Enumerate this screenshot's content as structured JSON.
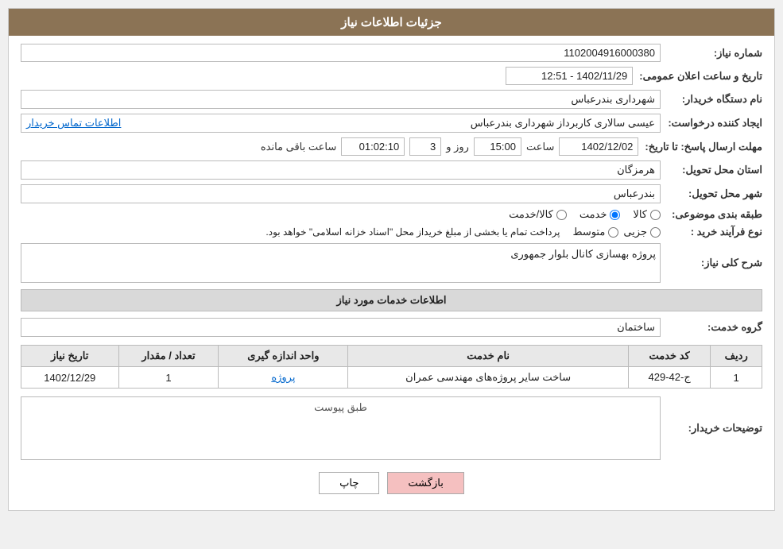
{
  "page": {
    "title": "جزئیات اطلاعات نیاز"
  },
  "fields": {
    "need_number_label": "شماره نیاز:",
    "need_number_value": "1102004916000380",
    "announce_datetime_label": "تاریخ و ساعت اعلان عمومی:",
    "announce_datetime_value": "1402/11/29 - 12:51",
    "buyer_org_label": "نام دستگاه خریدار:",
    "buyer_org_value": "شهرداری بندرعباس",
    "creator_label": "ایجاد کننده درخواست:",
    "creator_value": "عیسی سالاری کاربرداز شهرداری بندرعباس",
    "contact_info_link": "اطلاعات تماس خریدار",
    "send_date_label": "مهلت ارسال پاسخ: تا تاریخ:",
    "send_date_value": "1402/12/02",
    "send_time_label": "ساعت",
    "send_time_value": "15:00",
    "send_day_label": "روز و",
    "send_day_value": "3",
    "remaining_label": "ساعت باقی مانده",
    "remaining_value": "01:02:10",
    "province_label": "استان محل تحویل:",
    "province_value": "هرمزگان",
    "city_label": "شهر محل تحویل:",
    "city_value": "بندرعباس",
    "category_label": "طبقه بندی موضوعی:",
    "category_options": [
      "کالا",
      "خدمت",
      "کالا/خدمت"
    ],
    "category_selected": "خدمت",
    "process_type_label": "نوع فرآیند خرید :",
    "process_options": [
      "جزیی",
      "متوسط"
    ],
    "process_text": "پرداخت تمام یا بخشی از مبلغ خریداز محل \"اسناد خزانه اسلامی\" خواهد بود.",
    "need_desc_label": "شرح کلی نیاز:",
    "need_desc_value": "پروژه بهسازی کانال بلوار جمهوری",
    "services_section": "اطلاعات خدمات مورد نیاز",
    "service_group_label": "گروه خدمت:",
    "service_group_value": "ساختمان",
    "table_headers": [
      "ردیف",
      "کد خدمت",
      "نام خدمت",
      "واحد اندازه گیری",
      "تعداد / مقدار",
      "تاریخ نیاز"
    ],
    "table_rows": [
      {
        "row": "1",
        "service_code": "ج-42-429",
        "service_name": "ساخت سایر پروژه‌های مهندسی عمران",
        "unit": "پروژه",
        "quantity": "1",
        "date": "1402/12/29"
      }
    ],
    "buyer_desc_label": "توضیحات خریدار:",
    "buyer_desc_inner_label": "طبق پیوست",
    "btn_print": "چاپ",
    "btn_back": "بازگشت"
  }
}
